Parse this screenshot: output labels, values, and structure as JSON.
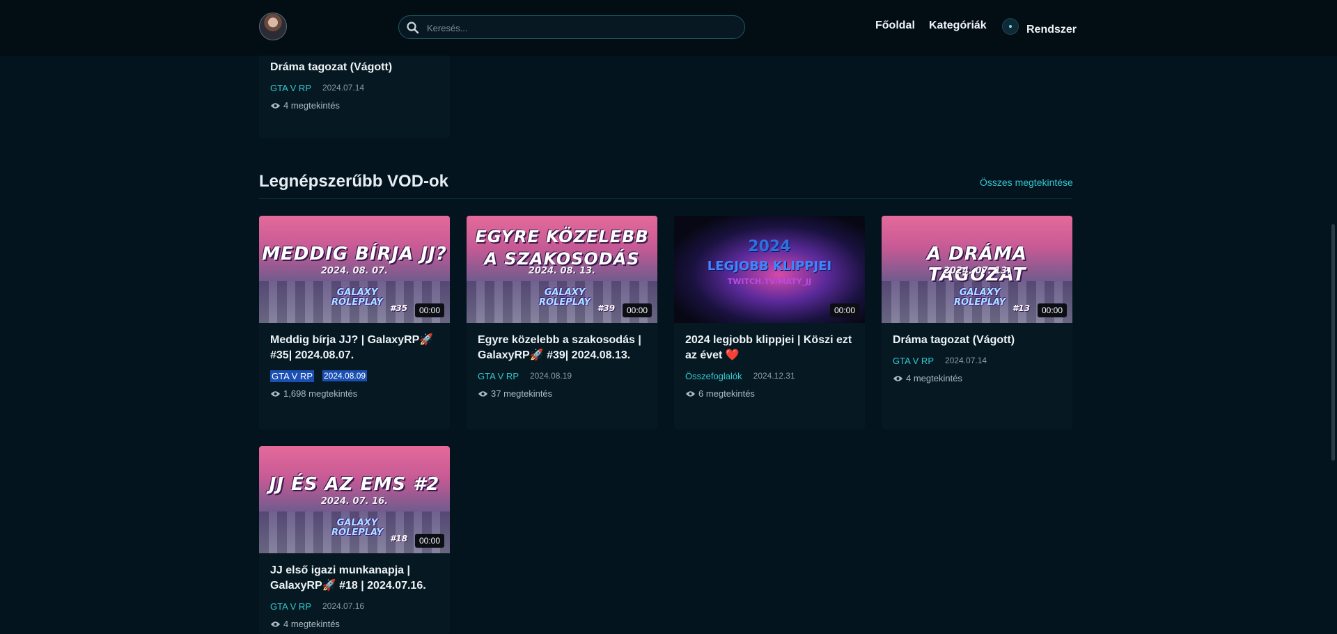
{
  "header": {
    "search_placeholder": "Keresés...",
    "nav": [
      "Főoldal",
      "Kategóriák",
      "Rendszer"
    ]
  },
  "top_card": {
    "title": "Dráma tagozat (Vágott)",
    "category": "GTA V RP",
    "date": "2024.07.14",
    "views": "4 megtekintés"
  },
  "section": {
    "title": "Legnépszerűbb VOD-ok",
    "see_all": "Összes megtekintése"
  },
  "cards": [
    {
      "thumb_title": "MEDDIG BÍRJA JJ?",
      "thumb_date": "2024. 08. 07.",
      "thumb_logo": "GALAXY ROLEPLAY",
      "thumb_ep": "#35",
      "duration": "00:00",
      "title": "Meddig bírja JJ? | GalaxyRP🚀 #35| 2024.08.07.",
      "category": "GTA V RP",
      "date": "2024.08.09",
      "views": "1,698 megtekintés"
    },
    {
      "thumb_title": "EGYRE KÖZELEBB A SZAKOSODÁS",
      "thumb_date": "2024. 08. 13.",
      "thumb_logo": "GALAXY ROLEPLAY",
      "thumb_ep": "#39",
      "duration": "00:00",
      "title": "Egyre közelebb a szakosodás | GalaxyRP🚀 #39| 2024.08.13.",
      "category": "GTA V RP",
      "date": "2024.08.19",
      "views": "37 megtekintés"
    },
    {
      "thumb_line1": "2024",
      "thumb_line2": "LEGJOBB KLIPPJEI",
      "thumb_line3": "TWITCH.TV/MATY_JJ",
      "duration": "00:00",
      "title": "2024 legjobb klippjei | Köszi ezt az évet ❤️",
      "category": "Összefoglalók",
      "date": "2024.12.31",
      "views": "6 megtekintés"
    },
    {
      "thumb_title": "A DRÁMA TAGOZAT",
      "thumb_date": "2024. 07. 13.",
      "thumb_logo": "GALAXY ROLEPLAY",
      "thumb_ep": "#13",
      "duration": "00:00",
      "title": "Dráma tagozat (Vágott)",
      "category": "GTA V RP",
      "date": "2024.07.14",
      "views": "4 megtekintés"
    },
    {
      "thumb_title": "JJ ÉS AZ EMS #2",
      "thumb_date": "2024. 07. 16.",
      "thumb_logo": "GALAXY ROLEPLAY",
      "thumb_ep": "#18",
      "duration": "00:00",
      "title": "JJ első igazi munkanapja | GalaxyRP🚀 #18 | 2024.07.16.",
      "category": "GTA V RP",
      "date": "2024.07.16",
      "views": "4 megtekintés"
    }
  ]
}
